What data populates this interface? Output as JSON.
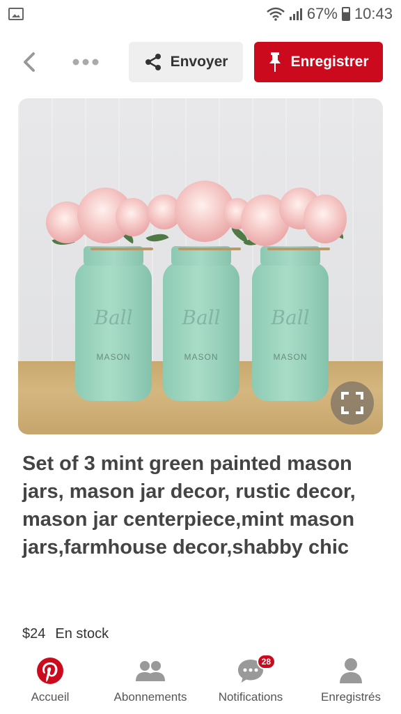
{
  "status_bar": {
    "battery": "67%",
    "time": "10:43",
    "icons": [
      "image-icon",
      "wifi-icon",
      "signal-icon",
      "battery-icon"
    ]
  },
  "action_bar": {
    "send_label": "Envoyer",
    "save_label": "Enregistrer",
    "icons": [
      "back-chevron-icon",
      "more-icon",
      "share-icon",
      "pin-icon"
    ]
  },
  "pin": {
    "image_brand_text": "Ball",
    "image_mason_text": "MASON",
    "title": "Set of 3 mint green painted mason jars, mason jar decor, rustic decor, mason jar centerpiece,mint mason jars,farmhouse decor,shabby chic",
    "price": "$24",
    "stock": "En stock"
  },
  "bottom_nav": {
    "items": [
      {
        "label": "Accueil",
        "icon": "pinterest-logo-icon"
      },
      {
        "label": "Abonnements",
        "icon": "people-icon"
      },
      {
        "label": "Notifications",
        "icon": "chat-bubble-icon",
        "badge": "28"
      },
      {
        "label": "Enregistrés",
        "icon": "profile-icon"
      }
    ]
  },
  "colors": {
    "brand_red": "#cc0a1d",
    "jar_mint": "#a9dcc7"
  }
}
